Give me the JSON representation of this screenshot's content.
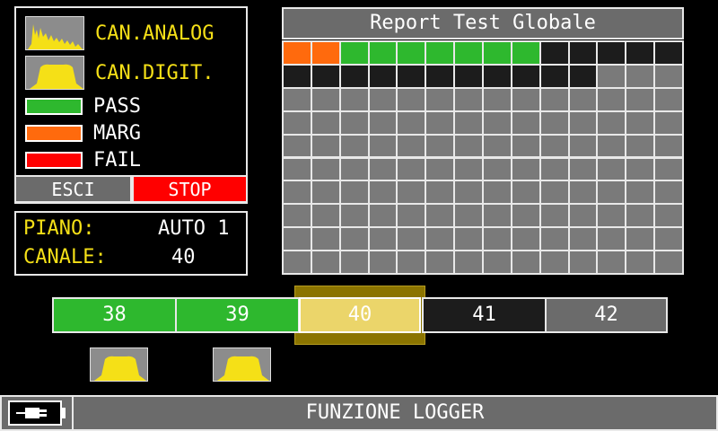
{
  "legend": {
    "analog_label": "CAN.ANALOG",
    "digital_label": "CAN.DIGIT.",
    "pass_label": "PASS",
    "marg_label": "MARG",
    "fail_label": "FAIL",
    "colors": {
      "pass": "#2eb82e",
      "marg": "#ff6a0d",
      "fail": "#ff0000",
      "accent": "#f5e017"
    }
  },
  "buttons": {
    "esci": "ESCI",
    "stop": "STOP"
  },
  "info": {
    "piano_key": "PIANO:",
    "piano_val": "AUTO 1",
    "canale_key": "CANALE:",
    "canale_val": "40"
  },
  "report": {
    "title": "Report Test Globale",
    "rows": 10,
    "cols": 14,
    "row0": [
      "marg",
      "marg",
      "pass",
      "pass",
      "pass",
      "pass",
      "pass",
      "pass",
      "pass",
      "black",
      "black",
      "black",
      "black",
      "black"
    ],
    "row1": [
      "black",
      "black",
      "black",
      "black",
      "black",
      "black",
      "black",
      "black",
      "black",
      "black",
      "black",
      "gray",
      "gray",
      "gray"
    ],
    "cell_colors": {
      "pass": "#2eb82e",
      "marg": "#ff6a0d",
      "black": "#1c1c1c",
      "gray": "#7a7a7a"
    }
  },
  "channels": {
    "items": [
      {
        "label": "38",
        "status": "pass"
      },
      {
        "label": "39",
        "status": "pass"
      },
      {
        "label": "40",
        "status": "selected"
      },
      {
        "label": "41",
        "status": "black"
      },
      {
        "label": "42",
        "status": "gray"
      }
    ],
    "icons": [
      "digital-spectrum-icon",
      "digital-spectrum-icon"
    ]
  },
  "footer": {
    "title": "FUNZIONE LOGGER",
    "icon": "battery-plug-icon"
  }
}
